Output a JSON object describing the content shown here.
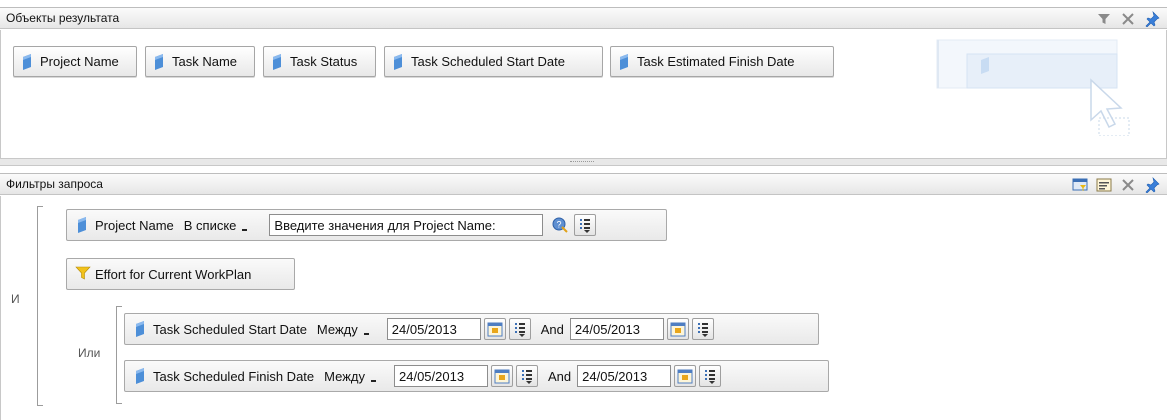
{
  "result_objects": {
    "title": "Объекты результата",
    "items": [
      {
        "label": "Project Name"
      },
      {
        "label": "Task Name"
      },
      {
        "label": "Task Status"
      },
      {
        "label": "Task Scheduled Start Date"
      },
      {
        "label": "Task Estimated Finish Date"
      }
    ]
  },
  "query_filters": {
    "title": "Фильтры запроса",
    "outer_operator": "И",
    "inner_operator": "Или",
    "filter1": {
      "object": "Project Name",
      "operator": "В списке",
      "value": "Введите значения для Project Name:"
    },
    "filter2": {
      "object": "Effort for Current WorkPlan"
    },
    "filter3": {
      "object": "Task Scheduled Start Date",
      "operator": "Между",
      "from": "24/05/2013",
      "and_label": "And",
      "to": "24/05/2013"
    },
    "filter4": {
      "object": "Task Scheduled Finish Date",
      "operator": "Между",
      "from": "24/05/2013",
      "and_label": "And",
      "to": "24/05/2013"
    }
  },
  "colors": {
    "dimension_blue": "#4d8fd8",
    "filter_yellow": "#f2c21b",
    "accent_blue": "#2f6fc6"
  }
}
